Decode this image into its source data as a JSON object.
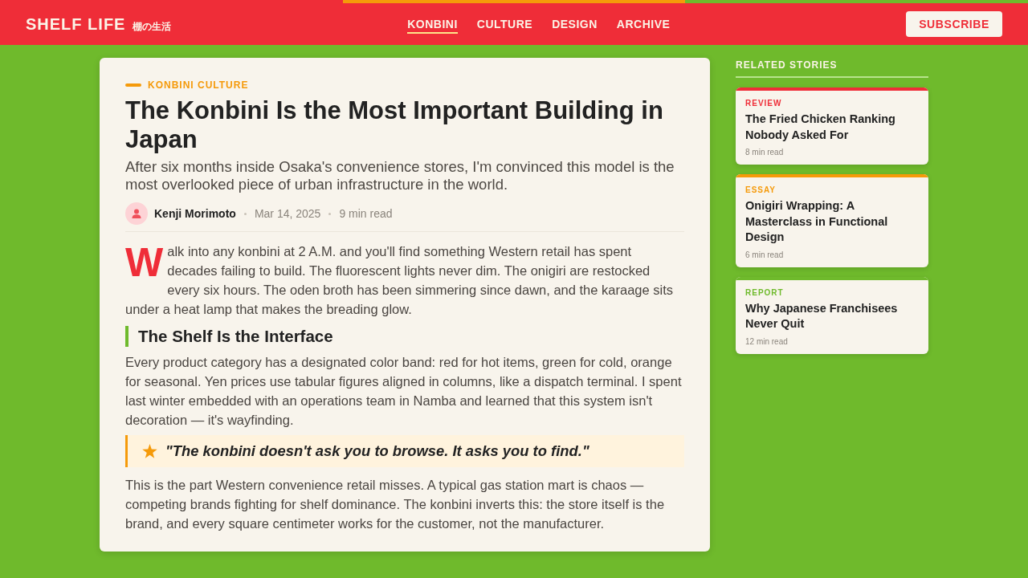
{
  "header": {
    "logo": {
      "name": "SHELF LIFE",
      "tagline": "棚の生活"
    },
    "nav": [
      {
        "label": "KONBINI",
        "selected": true
      },
      {
        "label": "CULTURE",
        "selected": false
      },
      {
        "label": "DESIGN",
        "selected": false
      },
      {
        "label": "ARCHIVE",
        "selected": false
      }
    ],
    "subscribe_button": "SUBSCRIBE"
  },
  "article": {
    "kicker": "KONBINI CULTURE",
    "title": "The Konbini Is the Most Important Building in Japan",
    "subtitle": "After six months inside Osaka's convenience stores, I'm convinced this model is the most overlooked piece of urban infrastructure in the world.",
    "byline": {
      "author": "Kenji Morimoto",
      "date": "Mar 14, 2025",
      "read_time": "9 min read"
    },
    "body": [
      {
        "kind": "lead",
        "text": "Walk into any konbini at 2 A.M. and you'll find something Western retail has spent decades failing to build. The fluorescent lights never dim. The onigiri are restocked every six hours. The oden broth has been simmering since dawn, and the karaage sits under a heat lamp that makes the breading glow."
      },
      {
        "kind": "heading",
        "text": "The Shelf Is the Interface"
      },
      {
        "kind": "paragraph",
        "text": "Every product category has a designated color band: red for hot items, green for cold, orange for seasonal. Yen prices use tabular figures aligned in columns, like a dispatch terminal. I spent last winter embedded with an operations team in Namba and learned that this system isn't decoration — it's wayfinding."
      },
      {
        "kind": "quote",
        "text": "\"The konbini doesn't ask you to browse. It asks you to find.\""
      },
      {
        "kind": "paragraph",
        "text": "This is the part Western convenience retail misses. A typical gas station mart is chaos — competing brands fighting for shelf dominance. The konbini inverts this: the store itself is the brand, and every square centimeter works for the customer, not the manufacturer."
      }
    ]
  },
  "sidebar": {
    "title": "RELATED STORIES",
    "stories": [
      {
        "category": "REVIEW",
        "color": "#ef2d38",
        "title": "The Fried Chicken Ranking Nobody Asked For",
        "read_time": "8 min read"
      },
      {
        "category": "ESSAY",
        "color": "#f59a0a",
        "title": "Onigiri Wrapping: A Masterclass in Functional Design",
        "read_time": "6 min read"
      },
      {
        "category": "REPORT",
        "color": "#6fba2c",
        "title": "Why Japanese Franchisees Never Quit",
        "read_time": "12 min read"
      }
    ]
  }
}
